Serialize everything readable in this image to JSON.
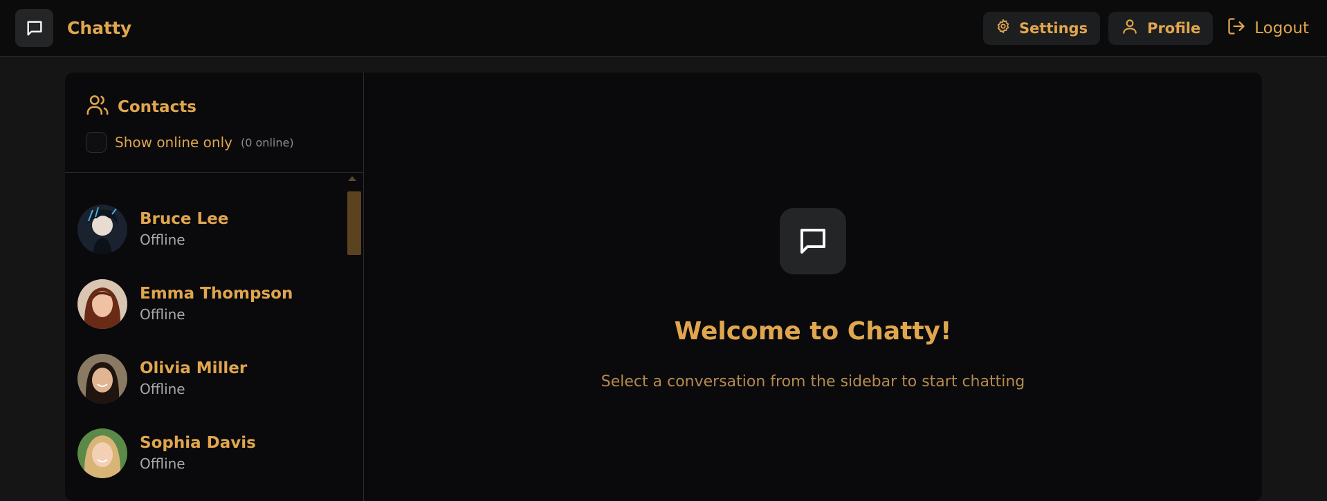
{
  "app": {
    "name": "Chatty"
  },
  "nav": {
    "settings_label": "Settings",
    "profile_label": "Profile",
    "logout_label": "Logout"
  },
  "sidebar": {
    "title": "Contacts",
    "online_toggle_label": "Show online only",
    "online_count": "(0 online)",
    "contacts": [
      {
        "name": "Bruce Lee",
        "status": "Offline"
      },
      {
        "name": "Emma Thompson",
        "status": "Offline"
      },
      {
        "name": "Olivia Miller",
        "status": "Offline"
      },
      {
        "name": "Sophia Davis",
        "status": "Offline"
      }
    ]
  },
  "main": {
    "welcome_title": "Welcome to Chatty!",
    "welcome_subtitle": "Select a conversation from the sidebar to start chatting"
  },
  "colors": {
    "accent": "#e0a64e",
    "background": "#0a0a0c",
    "muted_text": "#a9a9a9"
  }
}
